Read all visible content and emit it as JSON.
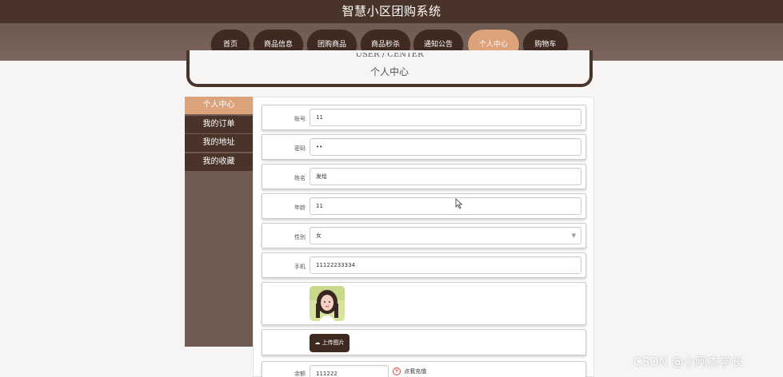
{
  "header": {
    "site_title": "智慧小区团购系统"
  },
  "nav": {
    "items": [
      {
        "label": "首页",
        "active": false
      },
      {
        "label": "商品信息",
        "active": false
      },
      {
        "label": "团购商品",
        "active": false
      },
      {
        "label": "商品秒杀",
        "active": false
      },
      {
        "label": "通知公告",
        "active": false
      },
      {
        "label": "个人中心",
        "active": true
      },
      {
        "label": "购物车",
        "active": false
      }
    ]
  },
  "user_center": {
    "title_en": "USER / CENTER",
    "title_cn": "个人中心"
  },
  "sidebar": {
    "items": [
      {
        "label": "个人中心",
        "active": true
      },
      {
        "label": "我的订单",
        "active": false
      },
      {
        "label": "我的地址",
        "active": false
      },
      {
        "label": "我的收藏",
        "active": false
      }
    ]
  },
  "form": {
    "account": {
      "label": "账号",
      "value": "11"
    },
    "password": {
      "label": "密码",
      "value": "••"
    },
    "name": {
      "label": "姓名",
      "value": "发给"
    },
    "age": {
      "label": "年龄",
      "value": "11"
    },
    "gender": {
      "label": "性别",
      "value": "女"
    },
    "phone": {
      "label": "手机",
      "value": "11122233334"
    },
    "upload_label": "上传图片",
    "balance": {
      "label": "余额",
      "value": "111222",
      "recharge_label": "点我充值"
    }
  },
  "watermark": "CSDN @小阿杰学长",
  "colors": {
    "dark_brown": "#4a3328",
    "accent": "#dca37a",
    "sidebar_bg": "#6f5b52"
  }
}
